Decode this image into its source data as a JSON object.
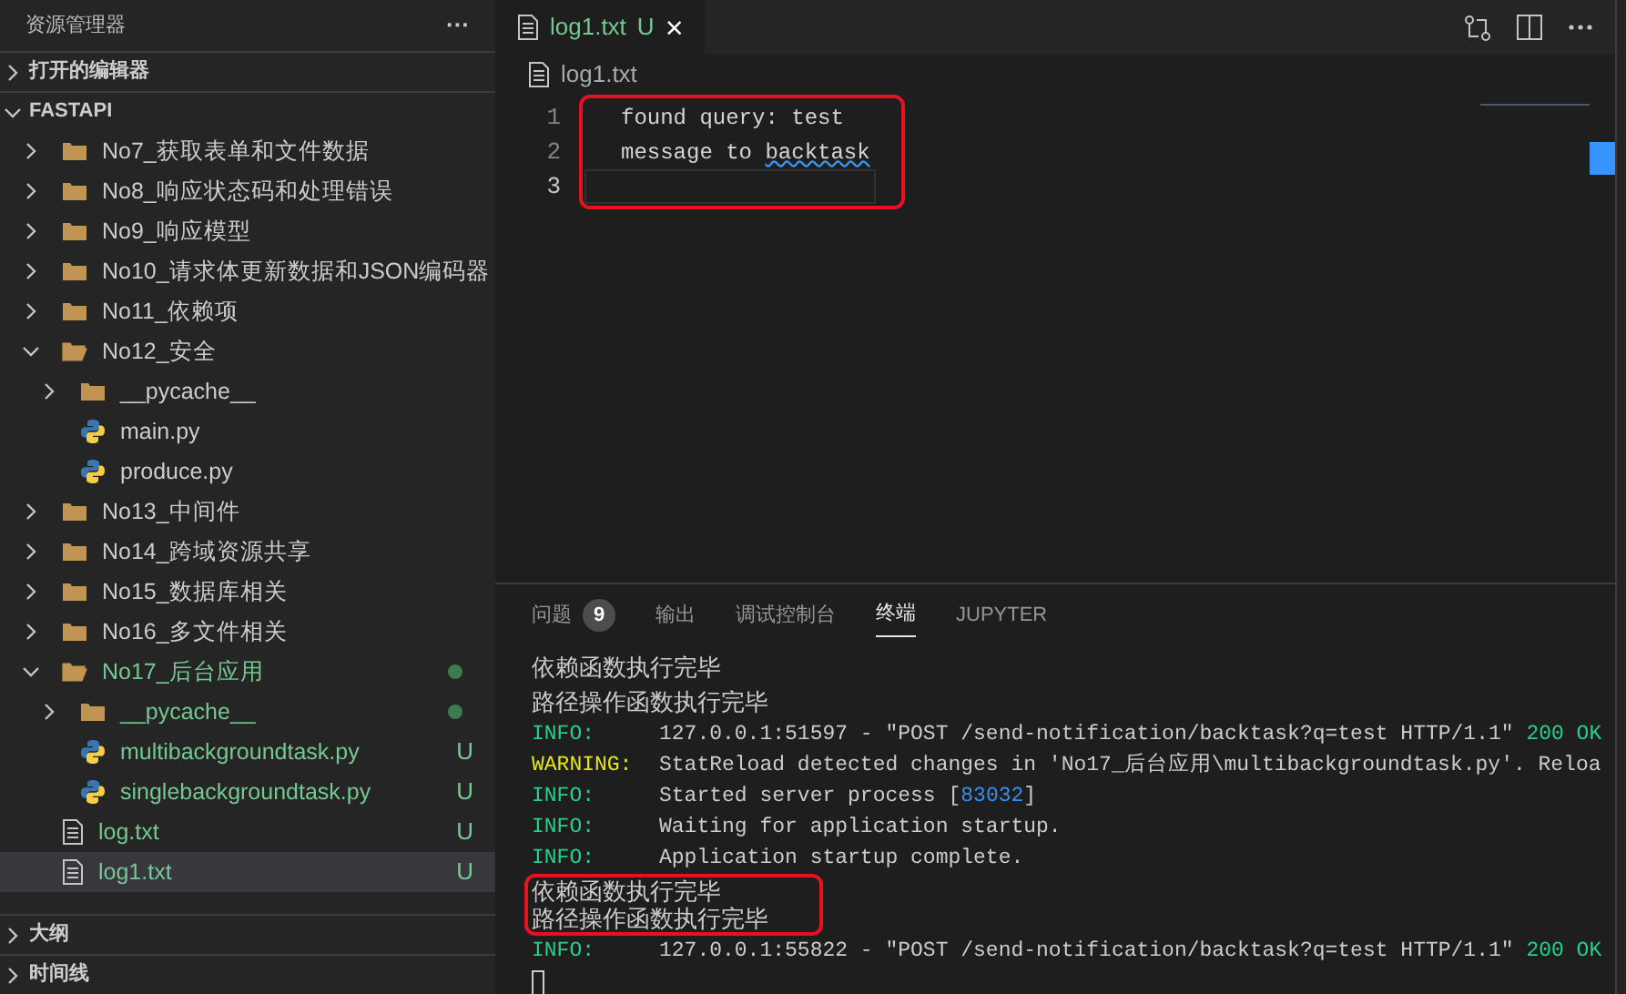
{
  "sidebar": {
    "title": "资源管理器",
    "more": "···",
    "sections_top": [
      {
        "label": "打开的编辑器",
        "expanded": false
      },
      {
        "label": "FASTAPI",
        "expanded": true
      }
    ],
    "tree": [
      {
        "name": "No7_获取表单和文件数据",
        "kind": "folder",
        "expanded": false,
        "untracked": false,
        "selected": false
      },
      {
        "name": "No8_响应状态码和处理错误",
        "kind": "folder",
        "expanded": false,
        "untracked": false,
        "selected": false
      },
      {
        "name": "No9_响应模型",
        "kind": "folder",
        "expanded": false,
        "untracked": false,
        "selected": false
      },
      {
        "name": "No10_请求体更新数据和JSON编码器",
        "kind": "folder",
        "expanded": false,
        "untracked": false,
        "selected": false
      },
      {
        "name": "No11_依赖项",
        "kind": "folder",
        "expanded": false,
        "untracked": false,
        "selected": false
      },
      {
        "name": "No12_安全",
        "kind": "folder",
        "expanded": true,
        "untracked": false,
        "selected": false,
        "children": [
          {
            "name": "__pycache__",
            "kind": "folder",
            "expanded": false,
            "untracked": false,
            "selected": false
          },
          {
            "name": "main.py",
            "kind": "python",
            "untracked": false,
            "selected": false
          },
          {
            "name": "produce.py",
            "kind": "python",
            "untracked": false,
            "selected": false
          }
        ]
      },
      {
        "name": "No13_中间件",
        "kind": "folder",
        "expanded": false,
        "untracked": false,
        "selected": false
      },
      {
        "name": "No14_跨域资源共享",
        "kind": "folder",
        "expanded": false,
        "untracked": false,
        "selected": false
      },
      {
        "name": "No15_数据库相关",
        "kind": "folder",
        "expanded": false,
        "untracked": false,
        "selected": false
      },
      {
        "name": "No16_多文件相关",
        "kind": "folder",
        "expanded": false,
        "untracked": false,
        "selected": false
      },
      {
        "name": "No17_后台应用",
        "kind": "folder",
        "expanded": true,
        "untracked": true,
        "selected": false,
        "children": [
          {
            "name": "__pycache__",
            "kind": "folder",
            "expanded": false,
            "untracked": true,
            "selected": false
          },
          {
            "name": "multibackgroundtask.py",
            "kind": "python",
            "untracked": true,
            "badge": "U",
            "selected": false
          },
          {
            "name": "singlebackgroundtask.py",
            "kind": "python",
            "untracked": true,
            "badge": "U",
            "selected": false
          }
        ]
      },
      {
        "name": "log.txt",
        "kind": "text",
        "untracked": true,
        "badge": "U",
        "selected": false
      },
      {
        "name": "log1.txt",
        "kind": "text",
        "untracked": true,
        "badge": "U",
        "selected": true
      }
    ],
    "sections_bottom": [
      {
        "label": "大纲",
        "expanded": false
      },
      {
        "label": "时间线",
        "expanded": false
      }
    ]
  },
  "editor": {
    "tabs": [
      {
        "title": "log1.txt",
        "badge": "U",
        "close": "×",
        "selected": true,
        "untracked": true
      }
    ],
    "breadcrumb": "log1.txt",
    "highlighted": true,
    "lines": [
      {
        "number": "1",
        "text": "found query: test",
        "current": false
      },
      {
        "number": "2",
        "text": "message to ",
        "squiggle": "backtask",
        "current": false
      },
      {
        "number": "3",
        "current": true
      }
    ]
  },
  "panel": {
    "tabs": [
      {
        "label": "问题",
        "count": "9",
        "selected": false
      },
      {
        "label": "输出",
        "selected": false
      },
      {
        "label": "调试控制台",
        "selected": false
      },
      {
        "label": "终端",
        "selected": true
      },
      {
        "label": "JUPYTER",
        "selected": false
      }
    ],
    "terminal": [
      {
        "kind": "plain",
        "text": "依赖函数执行完毕",
        "highlighted": false
      },
      {
        "kind": "plain",
        "text": "路径操作函数执行完毕",
        "highlighted": false
      },
      {
        "kind": "log",
        "level": "INFO:",
        "color": "#23d18b",
        "highlighted": false,
        "segments": [
          {
            "text": "127.0.0.1:51597 - \"POST /send-notification/backtask?q=test HTTP/1.1\" ",
            "kind": "plain"
          },
          {
            "text": "200 OK",
            "kind": "status"
          }
        ]
      },
      {
        "kind": "log",
        "level": "WARNING:",
        "color": "#e5e510",
        "highlighted": false,
        "segments": [
          {
            "text": "StatReload detected changes in 'No17_后台应用\\multibackgroundtask.py'. Reloa",
            "kind": "plain"
          }
        ]
      },
      {
        "kind": "log",
        "level": "INFO:",
        "color": "#23d18b",
        "highlighted": false,
        "segments": [
          {
            "text": "Started server process [",
            "kind": "plain"
          },
          {
            "text": "83032",
            "kind": "number"
          },
          {
            "text": "]",
            "kind": "plain"
          }
        ]
      },
      {
        "kind": "log",
        "level": "INFO:",
        "color": "#23d18b",
        "highlighted": false,
        "segments": [
          {
            "text": "Waiting for application startup.",
            "kind": "plain"
          }
        ]
      },
      {
        "kind": "log",
        "level": "INFO:",
        "color": "#23d18b",
        "highlighted": false,
        "segments": [
          {
            "text": "Application startup complete.",
            "kind": "plain"
          }
        ]
      },
      {
        "kind": "plain",
        "text": "依赖函数执行完毕",
        "highlighted": true
      },
      {
        "kind": "plain",
        "text": "路径操作函数执行完毕",
        "highlighted": true
      },
      {
        "kind": "log",
        "level": "INFO:",
        "color": "#23d18b",
        "highlighted": false,
        "segments": [
          {
            "text": "127.0.0.1:55822 - \"POST /send-notification/backtask?q=test HTTP/1.1\" ",
            "kind": "plain"
          },
          {
            "text": "200 OK",
            "kind": "status"
          }
        ]
      },
      {
        "kind": "cursor",
        "highlighted": false
      }
    ]
  }
}
